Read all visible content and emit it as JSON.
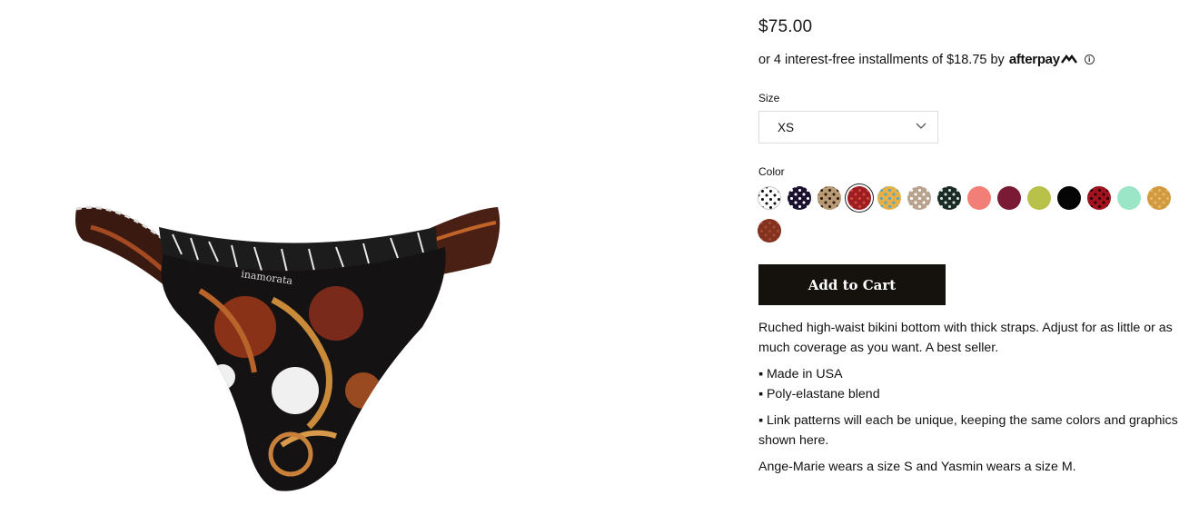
{
  "product": {
    "price": "$75.00",
    "afterpay": {
      "text": "or 4 interest-free installments of $18.75 by",
      "brand": "afterpay",
      "info_icon": "info-icon"
    },
    "size": {
      "label": "Size",
      "selected": "XS"
    },
    "color": {
      "label": "Color",
      "swatches": [
        {
          "name": "polka-dot-white",
          "bg": "#ffffff",
          "dots": "#111111"
        },
        {
          "name": "polka-dot-navy",
          "bg": "#1b1230",
          "dots": "#ffffff"
        },
        {
          "name": "leopard",
          "bg": "#b89a74",
          "dots": "#2a1d12"
        },
        {
          "name": "red-link",
          "bg": "#9c1d22",
          "dots": "#d64a3a",
          "selected": true
        },
        {
          "name": "multi-print",
          "bg": "#e7b046",
          "dots": "#4aa8c8"
        },
        {
          "name": "taupe-dot",
          "bg": "#b8a38f",
          "dots": "#ffffff"
        },
        {
          "name": "green-print",
          "bg": "#1c2b27",
          "dots": "#cfe3d6"
        },
        {
          "name": "coral",
          "bg": "#f17f78"
        },
        {
          "name": "burgundy",
          "bg": "#7a1a34"
        },
        {
          "name": "lime",
          "bg": "#b8c14a"
        },
        {
          "name": "black",
          "bg": "#050505"
        },
        {
          "name": "red-snake",
          "bg": "#a4121d",
          "dots": "#220508"
        },
        {
          "name": "mint",
          "bg": "#9be6c6"
        },
        {
          "name": "mustard",
          "bg": "#d29a40",
          "dots": "#e8b866"
        },
        {
          "name": "brown",
          "bg": "#82321f",
          "dots": "#a34a33"
        }
      ]
    },
    "add_to_cart": "Add to Cart",
    "description": {
      "intro": "Ruched high-waist bikini bottom with thick straps. Adjust for as little or as much coverage as you want. A best seller.",
      "bullets_1": [
        "▪ Made in USA",
        "▪ Poly-elastane blend"
      ],
      "bullet_2": "▪ Link patterns will each be unique, keeping the same colors and graphics shown here.",
      "fit": "Ange-Marie wears a size S and Yasmin wears a size M."
    },
    "image_icon": "bikini-bottom-product-image"
  }
}
